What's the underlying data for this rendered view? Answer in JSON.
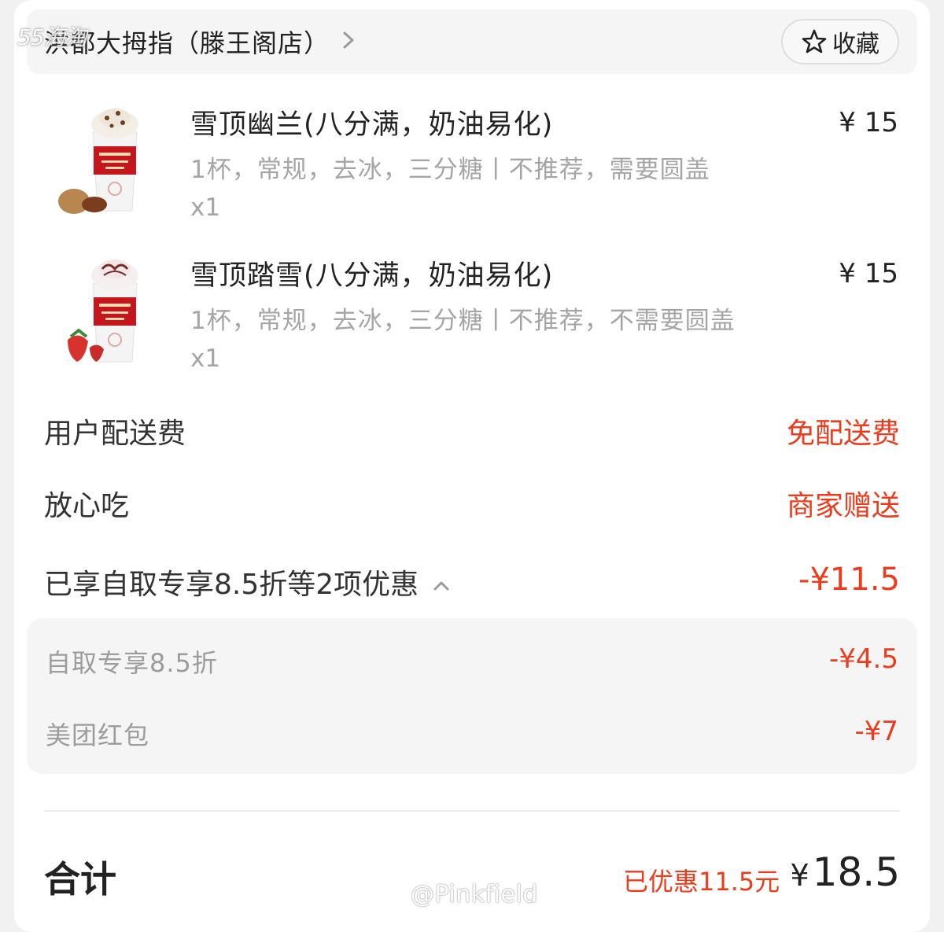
{
  "watermarks": {
    "top_left": "55海淘",
    "bottom": "@Pinkfield"
  },
  "store": {
    "name": "洪都大拇指（滕王阁店）",
    "favorite_label": "收藏"
  },
  "items": [
    {
      "name": "雪顶幽兰(八分满，奶油易化)",
      "spec": "1杯，常规，去冰，三分糖丨不推荐，需要圆盖",
      "qty": "x1",
      "price": "¥ 15",
      "garnish": "walnut"
    },
    {
      "name": "雪顶踏雪(八分满，奶油易化)",
      "spec": "1杯，常规，去冰，三分糖丨不推荐，不需要圆盖",
      "qty": "x1",
      "price": "¥ 15",
      "garnish": "strawberry"
    }
  ],
  "fees": [
    {
      "label": "用户配送费",
      "value": "免配送费"
    },
    {
      "label": "放心吃",
      "value": "商家赠送"
    }
  ],
  "discounts": {
    "summary_label": "已享自取专享8.5折等2项优惠",
    "summary_value": "-¥11.5",
    "details": [
      {
        "label": "自取专享8.5折",
        "value": "-¥4.5"
      },
      {
        "label": "美团红包",
        "value": "-¥7"
      }
    ]
  },
  "total": {
    "label": "合计",
    "saved_text": "已优惠11.5元",
    "currency": "¥",
    "amount": "18.5"
  },
  "colors": {
    "accent": "#ee3b1c",
    "text": "#222222",
    "muted": "#a5a5a5"
  }
}
